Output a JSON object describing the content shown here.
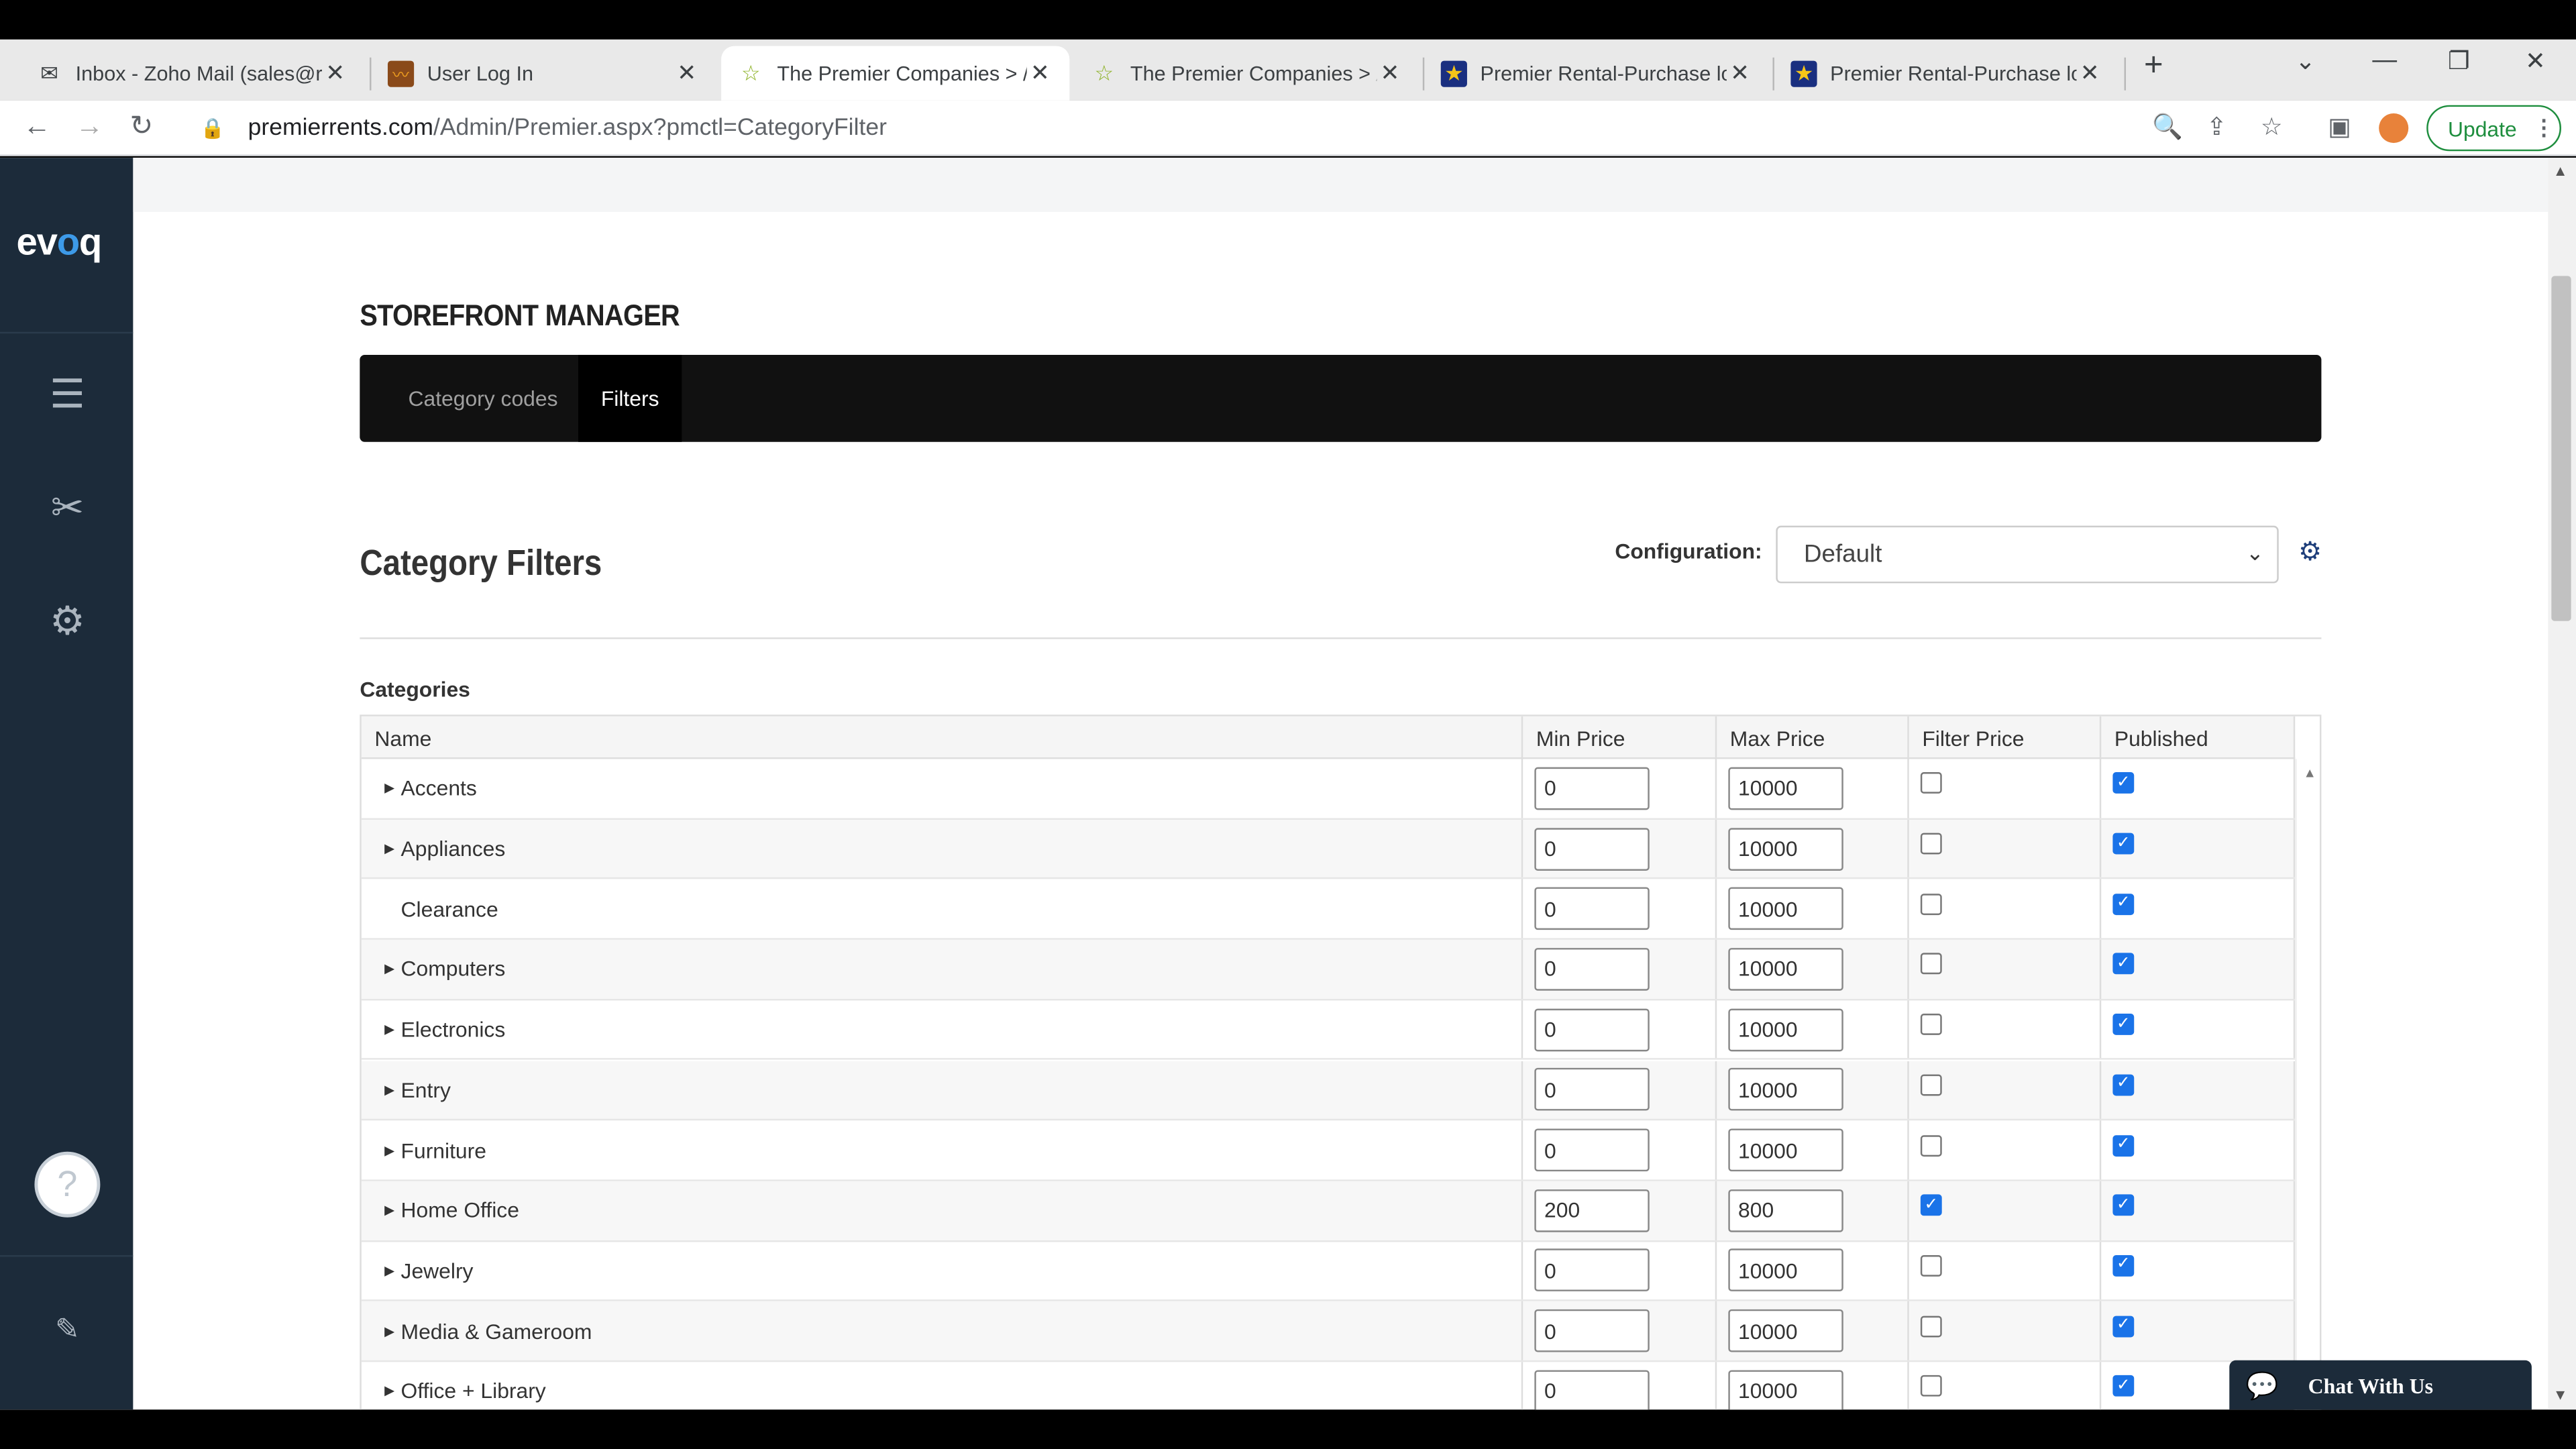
{
  "browser": {
    "tabs": [
      {
        "title": "Inbox - Zoho Mail (sales@r",
        "icon": "mail-icon",
        "active": false
      },
      {
        "title": "User Log In",
        "icon": "login-site-icon",
        "active": false
      },
      {
        "title": "The Premier Companies > /",
        "icon": "star-favicon",
        "active": true
      },
      {
        "title": "The Premier Companies > /",
        "icon": "star-favicon",
        "active": false
      },
      {
        "title": "Premier Rental-Purchase lo",
        "icon": "premier-star-favicon",
        "active": false
      },
      {
        "title": "Premier Rental-Purchase lo",
        "icon": "premier-star-favicon",
        "active": false
      }
    ],
    "url_host": "premierrents.com",
    "url_path": "/Admin/Premier.aspx?pmctl=CategoryFilter",
    "update_label": "Update"
  },
  "sidebar": {
    "logo_text_a": "ev",
    "logo_text_o": "o",
    "logo_text_b": "q"
  },
  "storefront": {
    "title": "STOREFRONT MANAGER",
    "tabs": [
      {
        "label": "Category codes",
        "active": false
      },
      {
        "label": "Filters",
        "active": true
      }
    ]
  },
  "filters": {
    "title": "Category Filters",
    "configuration_label": "Configuration:",
    "configuration_value": "Default",
    "categories_label": "Categories",
    "columns": [
      "Name",
      "Min Price",
      "Max Price",
      "Filter Price",
      "Published"
    ],
    "rows": [
      {
        "name": "Accents",
        "expandable": true,
        "min": "0",
        "max": "10000",
        "filter_price": false,
        "published": true
      },
      {
        "name": "Appliances",
        "expandable": true,
        "min": "0",
        "max": "10000",
        "filter_price": false,
        "published": true
      },
      {
        "name": "Clearance",
        "expandable": false,
        "min": "0",
        "max": "10000",
        "filter_price": false,
        "published": true
      },
      {
        "name": "Computers",
        "expandable": true,
        "min": "0",
        "max": "10000",
        "filter_price": false,
        "published": true
      },
      {
        "name": "Electronics",
        "expandable": true,
        "min": "0",
        "max": "10000",
        "filter_price": false,
        "published": true
      },
      {
        "name": "Entry",
        "expandable": true,
        "min": "0",
        "max": "10000",
        "filter_price": false,
        "published": true
      },
      {
        "name": "Furniture",
        "expandable": true,
        "min": "0",
        "max": "10000",
        "filter_price": false,
        "published": true
      },
      {
        "name": "Home Office",
        "expandable": true,
        "min": "200",
        "max": "800",
        "filter_price": true,
        "published": true
      },
      {
        "name": "Jewelry",
        "expandable": true,
        "min": "0",
        "max": "10000",
        "filter_price": false,
        "published": true
      },
      {
        "name": "Media & Gameroom",
        "expandable": true,
        "min": "0",
        "max": "10000",
        "filter_price": false,
        "published": true
      },
      {
        "name": "Office + Library",
        "expandable": true,
        "min": "0",
        "max": "10000",
        "filter_price": false,
        "published": true
      }
    ]
  },
  "chat": {
    "label": "Chat With Us"
  }
}
